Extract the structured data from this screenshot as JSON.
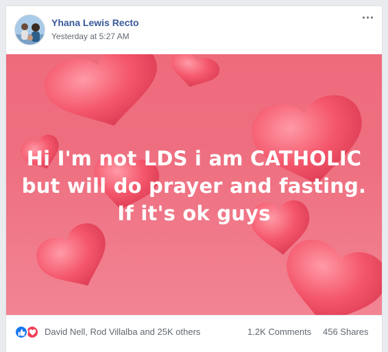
{
  "post": {
    "author": "Yhana Lewis Recto",
    "timestamp": "Yesterday at 5:27 AM",
    "more_icon": "more-options-icon",
    "text_lines": [
      "Hi I'm not LDS i am CATHOLIC",
      "but will do prayer and fasting.",
      "If it's ok guys"
    ],
    "background_color": "#ee6f80",
    "heart_color": "#f25c70"
  },
  "footer": {
    "reactions": [
      "like-icon",
      "love-icon"
    ],
    "reaction_names": "David Nell, Rod Villalba and 25K others",
    "comments": "1.2K Comments",
    "shares": "456 Shares"
  },
  "colors": {
    "author_link": "#385898",
    "meta_text": "#616770",
    "like_blue": "#1877f2",
    "love_red": "#f33e58"
  }
}
